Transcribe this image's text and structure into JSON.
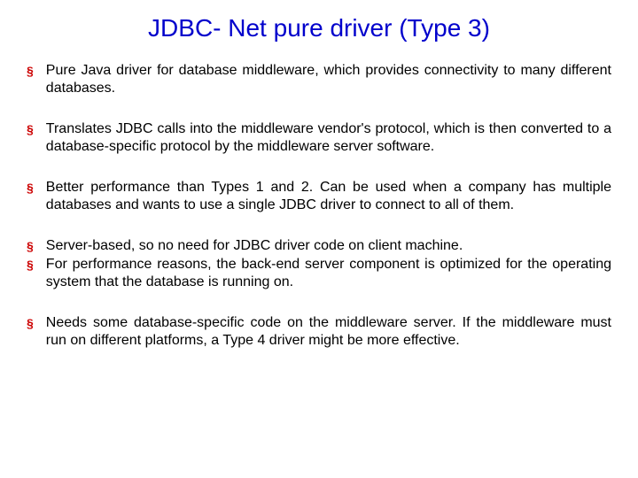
{
  "title": "JDBC- Net pure driver (Type 3)",
  "bullets": {
    "b1": "Pure Java driver for database middleware, which provides connectivity to many different databases.",
    "b2": "Translates JDBC calls into the middleware vendor's protocol, which is then converted to a database-specific protocol by the middleware server software.",
    "b3": "Better performance than Types 1 and 2. Can be used when a company has multiple databases and wants to use a single JDBC driver to connect to all of them.",
    "b4": "Server-based, so no need for JDBC driver code on client machine.",
    "b5": "For performance reasons, the back-end server component is optimized for the operating system that the database is running on.",
    "b6": "Needs some database-specific code on the middleware server. If the middleware must run on different platforms, a Type 4 driver might be more effective."
  }
}
